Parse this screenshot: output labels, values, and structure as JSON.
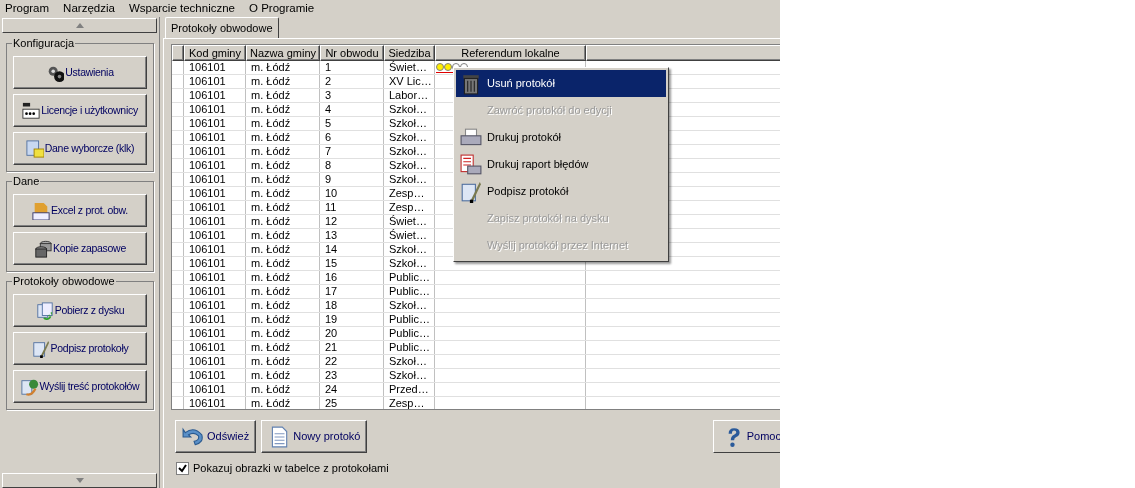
{
  "menu": [
    "Program",
    "Narzędzia",
    "Wsparcie techniczne",
    "O Programie"
  ],
  "sidebar": {
    "groups": [
      {
        "title": "Konfiguracja",
        "buttons": [
          {
            "label": "Ustawienia",
            "kind": "gears"
          },
          {
            "label": "Licencje i użytkownicy",
            "kind": "pin"
          },
          {
            "label": "Dane wyborcze (klk)",
            "kind": "grid"
          }
        ]
      },
      {
        "title": "Dane",
        "buttons": [
          {
            "label": "Excel z prot. obw.",
            "kind": "csv"
          },
          {
            "label": "Kopie zapasowe",
            "kind": "db"
          }
        ]
      },
      {
        "title": "Protokoły obwodowe",
        "buttons": [
          {
            "label": "Pobierz z dysku",
            "kind": "load"
          },
          {
            "label": "Podpisz protokoły",
            "kind": "sign"
          },
          {
            "label": "Wyślij treść protokołów",
            "kind": "send"
          }
        ]
      }
    ]
  },
  "tabs": [
    {
      "label": "Protokoły obwodowe",
      "selected": true
    }
  ],
  "table": {
    "columns": [
      "Kod gminy",
      "Nazwa gminy",
      "Nr obwodu",
      "Siedziba",
      "Referendum lokalne"
    ],
    "rows": [
      {
        "cells": [
          "106101",
          "m. Łódź",
          "1",
          "Świet…"
        ],
        "marks": [
          true,
          true,
          false,
          false
        ]
      },
      {
        "cells": [
          "106101",
          "m. Łódź",
          "2",
          "XV Lic…"
        ]
      },
      {
        "cells": [
          "106101",
          "m. Łódź",
          "3",
          "Labor…"
        ]
      },
      {
        "cells": [
          "106101",
          "m. Łódź",
          "4",
          "Szkoł…"
        ]
      },
      {
        "cells": [
          "106101",
          "m. Łódź",
          "5",
          "Szkoł…"
        ]
      },
      {
        "cells": [
          "106101",
          "m. Łódź",
          "6",
          "Szkoł…"
        ]
      },
      {
        "cells": [
          "106101",
          "m. Łódź",
          "7",
          "Szkoł…"
        ]
      },
      {
        "cells": [
          "106101",
          "m. Łódź",
          "8",
          "Szkoł…"
        ]
      },
      {
        "cells": [
          "106101",
          "m. Łódź",
          "9",
          "Szkoł…"
        ]
      },
      {
        "cells": [
          "106101",
          "m. Łódź",
          "10",
          "Zesp…"
        ]
      },
      {
        "cells": [
          "106101",
          "m. Łódź",
          "11",
          "Zesp…"
        ]
      },
      {
        "cells": [
          "106101",
          "m. Łódź",
          "12",
          "Świet…"
        ]
      },
      {
        "cells": [
          "106101",
          "m. Łódź",
          "13",
          "Świet…"
        ]
      },
      {
        "cells": [
          "106101",
          "m. Łódź",
          "14",
          "Szkoł…"
        ]
      },
      {
        "cells": [
          "106101",
          "m. Łódź",
          "15",
          "Szkoł…"
        ]
      },
      {
        "cells": [
          "106101",
          "m. Łódź",
          "16",
          "Public…"
        ]
      },
      {
        "cells": [
          "106101",
          "m. Łódź",
          "17",
          "Public…"
        ]
      },
      {
        "cells": [
          "106101",
          "m. Łódź",
          "18",
          "Szkoł…"
        ]
      },
      {
        "cells": [
          "106101",
          "m. Łódź",
          "19",
          "Public…"
        ]
      },
      {
        "cells": [
          "106101",
          "m. Łódź",
          "20",
          "Public…"
        ]
      },
      {
        "cells": [
          "106101",
          "m. Łódź",
          "21",
          "Public…"
        ]
      },
      {
        "cells": [
          "106101",
          "m. Łódź",
          "22",
          "Szkoł…"
        ]
      },
      {
        "cells": [
          "106101",
          "m. Łódź",
          "23",
          "Szkoł…"
        ]
      },
      {
        "cells": [
          "106101",
          "m. Łódź",
          "24",
          "Przed…"
        ]
      },
      {
        "cells": [
          "106101",
          "m. Łódź",
          "25",
          "Zesp…"
        ]
      }
    ]
  },
  "context_menu": [
    {
      "label": "Usuń protokół",
      "kind": "trash",
      "selected": true,
      "disabled": false
    },
    {
      "label": "Zawróć protokół do edycji",
      "selected": false,
      "disabled": true
    },
    {
      "label": "Drukuj protokół",
      "kind": "printer",
      "selected": false,
      "disabled": false
    },
    {
      "label": "Drukuj raport błędów",
      "kind": "report",
      "selected": false,
      "disabled": false
    },
    {
      "label": "Podpisz protokół",
      "kind": "sign",
      "selected": false,
      "disabled": false
    },
    {
      "label": "Zapisz protokół na dysku",
      "selected": false,
      "disabled": true
    },
    {
      "label": "Wyślij protokół przez Internet",
      "selected": false,
      "disabled": true
    }
  ],
  "buttons": [
    {
      "label": "Odśwież",
      "kind": "refresh"
    },
    {
      "label": "Nowy protokó",
      "kind": "doc"
    }
  ],
  "help_button": {
    "label": "Pomoc"
  },
  "checkbox": {
    "label": "Pokazuj obrazki w tabelce z protokołami",
    "checked": true
  }
}
